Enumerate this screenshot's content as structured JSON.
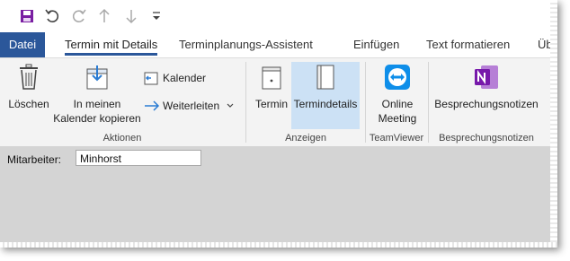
{
  "tabs": {
    "file": "Datei",
    "items": [
      "Termin mit Details",
      "Terminplanungs-Assistent",
      "Einfügen",
      "Text formatieren",
      "Üb"
    ]
  },
  "ribbon": {
    "loeschen": "Löschen",
    "kopieren_1": "In meinen",
    "kopieren_2": "Kalender kopieren",
    "kalender": "Kalender",
    "weiterleiten": "Weiterleiten",
    "group_aktionen": "Aktionen",
    "termin": "Termin",
    "termindetails": "Termindetails",
    "group_anzeigen": "Anzeigen",
    "online_1": "Online",
    "online_2": "Meeting",
    "group_teamviewer": "TeamViewer",
    "notizen": "Besprechungsnotizen",
    "group_notizen": "Besprechungsnotizen"
  },
  "form": {
    "label": "Mitarbeiter:",
    "value": "Minhorst"
  },
  "colors": {
    "accent": "#2b579a",
    "highlight": "#cce1f5",
    "onenote": "#7719aa",
    "teamviewer": "#0e8ee9"
  }
}
